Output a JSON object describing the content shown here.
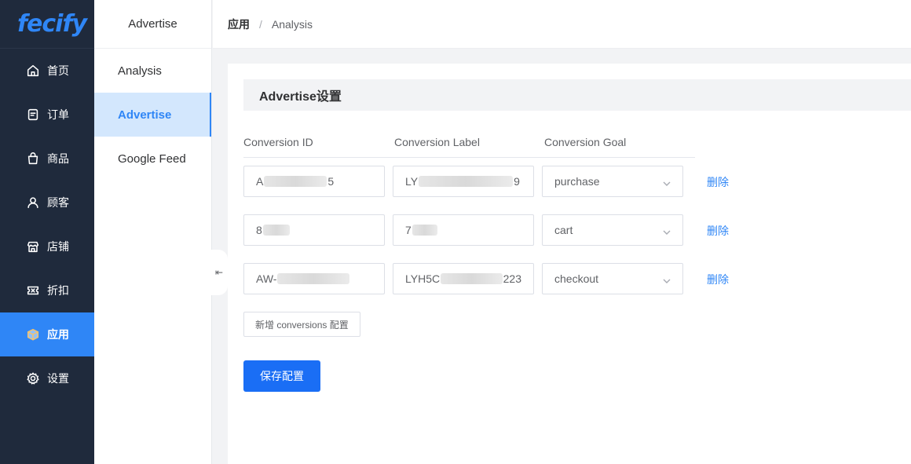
{
  "app": {
    "logo": "fecify"
  },
  "nav": {
    "items": [
      {
        "label": "首页",
        "icon": "home-icon"
      },
      {
        "label": "订单",
        "icon": "order-icon"
      },
      {
        "label": "商品",
        "icon": "bag-icon"
      },
      {
        "label": "顾客",
        "icon": "user-icon"
      },
      {
        "label": "店铺",
        "icon": "store-icon"
      },
      {
        "label": "折扣",
        "icon": "ticket-icon"
      },
      {
        "label": "应用",
        "icon": "box-icon",
        "active": true
      },
      {
        "label": "设置",
        "icon": "gear-icon"
      }
    ]
  },
  "subnav": {
    "title": "Advertise",
    "items": [
      {
        "label": "Analysis"
      },
      {
        "label": "Advertise",
        "active": true
      },
      {
        "label": "Google Feed"
      }
    ]
  },
  "breadcrumb": {
    "parent": "应用",
    "separator": "/",
    "current": "Analysis"
  },
  "section": {
    "title": "Advertise设置"
  },
  "table": {
    "headers": [
      "Conversion ID",
      "Conversion Label",
      "Conversion Goal"
    ],
    "rows": [
      {
        "id_prefix": "A",
        "id_suffix": "5",
        "label_prefix": "LY",
        "label_suffix": "9",
        "goal": "purchase",
        "delete": "删除"
      },
      {
        "id_prefix": "8",
        "id_suffix": "",
        "label_prefix": "7",
        "label_suffix": "",
        "goal": "cart",
        "delete": "删除"
      },
      {
        "id_prefix": "AW-",
        "id_suffix": "",
        "label_prefix": "LYH5C",
        "label_suffix": "223",
        "goal": "checkout",
        "delete": "删除"
      }
    ]
  },
  "buttons": {
    "add": "新增 conversions 配置",
    "save": "保存配置"
  },
  "colors": {
    "nav_bg": "#1f2a3c",
    "accent": "#2f86f6",
    "primary_button": "#1a6ef5",
    "subnav_active_bg": "#d3e7fd"
  }
}
